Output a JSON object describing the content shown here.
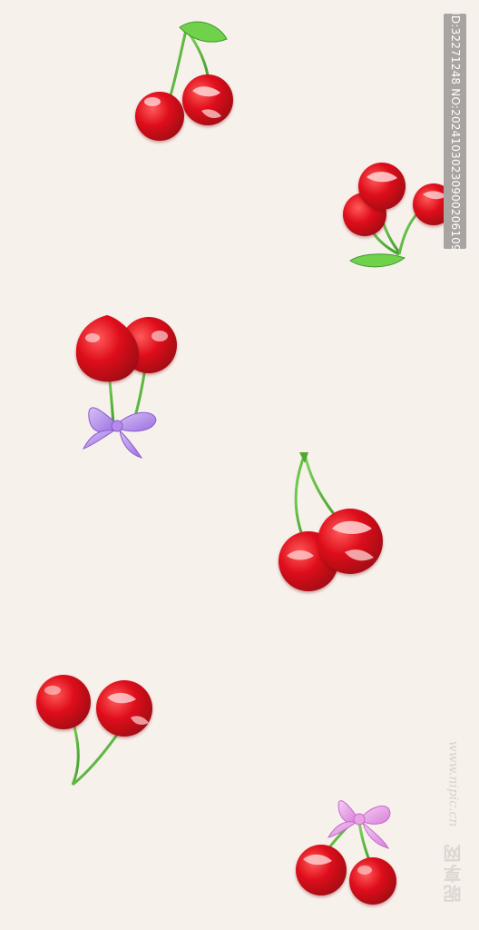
{
  "background_color": "#f7f1ec",
  "image_id": "ID:32271248 NO:20241030230900206109",
  "watermark": {
    "brand": "昵享网",
    "url": "www.nipic.cn"
  },
  "colors": {
    "cherry_red": "#e0101c",
    "cherry_highlight": "#ffd6d6",
    "stem_green": "#5cb83a",
    "leaf_green": "#6fd24a",
    "bow_purple": "#b48ce8",
    "bow_pink": "#e9a0e6"
  },
  "motifs": [
    "cherry-pair-with-leaf",
    "cherry-pair-with-leaf",
    "cherry-pair-with-purple-bow",
    "cherry-pair",
    "cherry-pair",
    "cherry-pair-with-pink-bow"
  ]
}
